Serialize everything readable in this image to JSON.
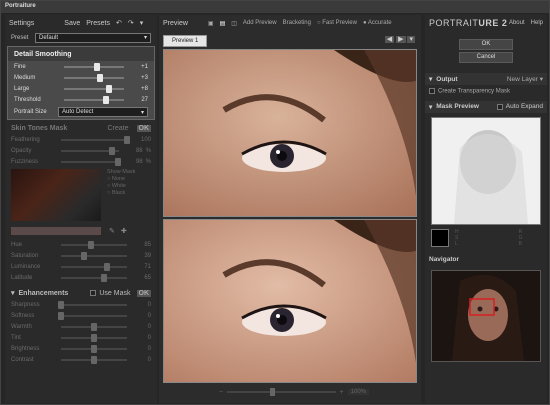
{
  "window": {
    "title": "Portraiture"
  },
  "left": {
    "header": "Settings",
    "save": "Save",
    "presets": "Presets",
    "preset_label": "Preset",
    "preset_value": "Default",
    "detail": {
      "title": "Detail Smoothing",
      "rows": [
        {
          "label": "Fine",
          "value": "+1",
          "level": 0.55
        },
        {
          "label": "Medium",
          "value": "+3",
          "level": 0.6
        },
        {
          "label": "Large",
          "value": "+8",
          "level": 0.75
        },
        {
          "label": "Threshold",
          "value": "27",
          "level": 0.7
        }
      ],
      "portrait_size_label": "Portrait Size",
      "portrait_size_value": "Auto Detect"
    },
    "skin": {
      "title": "Skin Tones Mask",
      "mode": "Create",
      "ok": "OK",
      "rows": [
        {
          "label": "Feathering",
          "value": "100",
          "level": 1.0
        },
        {
          "label": "Opacity",
          "value": "88",
          "unit": "%",
          "level": 0.88
        },
        {
          "label": "Fuzziness",
          "value": "98",
          "unit": "%",
          "level": 0.98
        }
      ],
      "show_mask": "Show Mask",
      "options": [
        "None",
        "White",
        "Black"
      ],
      "hsl": [
        {
          "label": "Hue",
          "value": "85",
          "level": 0.45
        },
        {
          "label": "Saturation",
          "value": "39",
          "level": 0.35
        },
        {
          "label": "Luminance",
          "value": "71",
          "level": 0.7
        },
        {
          "label": "Latitude",
          "value": "65",
          "level": 0.65
        }
      ]
    },
    "enh": {
      "title": "Enhancements",
      "use_mask": "Use Mask",
      "ok": "OK",
      "rows": [
        {
          "label": "Sharpness",
          "value": "0",
          "level": 0.0
        },
        {
          "label": "Softness",
          "value": "0",
          "level": 0.0
        },
        {
          "label": "Warmth",
          "value": "0",
          "level": 0.5
        },
        {
          "label": "Tint",
          "value": "0",
          "level": 0.5
        },
        {
          "label": "Brightness",
          "value": "0",
          "level": 0.5
        },
        {
          "label": "Contrast",
          "value": "0",
          "level": 0.5
        }
      ]
    }
  },
  "center": {
    "preview": "Preview",
    "add_preview": "Add Preview",
    "bracketing": "Bracketing",
    "fast_preview": "Fast Preview",
    "accurate": "Accurate",
    "tab": "Preview 1",
    "zoom": "100%"
  },
  "right": {
    "logo_a": "PORTRAIT",
    "logo_b": "URE 2",
    "about": "About",
    "help": "Help",
    "ok": "OK",
    "cancel": "Cancel",
    "output": "Output",
    "output_value": "New Layer",
    "transparency": "Create Transparency Mask",
    "mask_preview": "Mask Preview",
    "auto_expand": "Auto Expand",
    "hsl_left": [
      "H",
      "S",
      "L"
    ],
    "hsl_right": [
      "R",
      "G",
      "B"
    ],
    "navigator": "Navigator"
  }
}
